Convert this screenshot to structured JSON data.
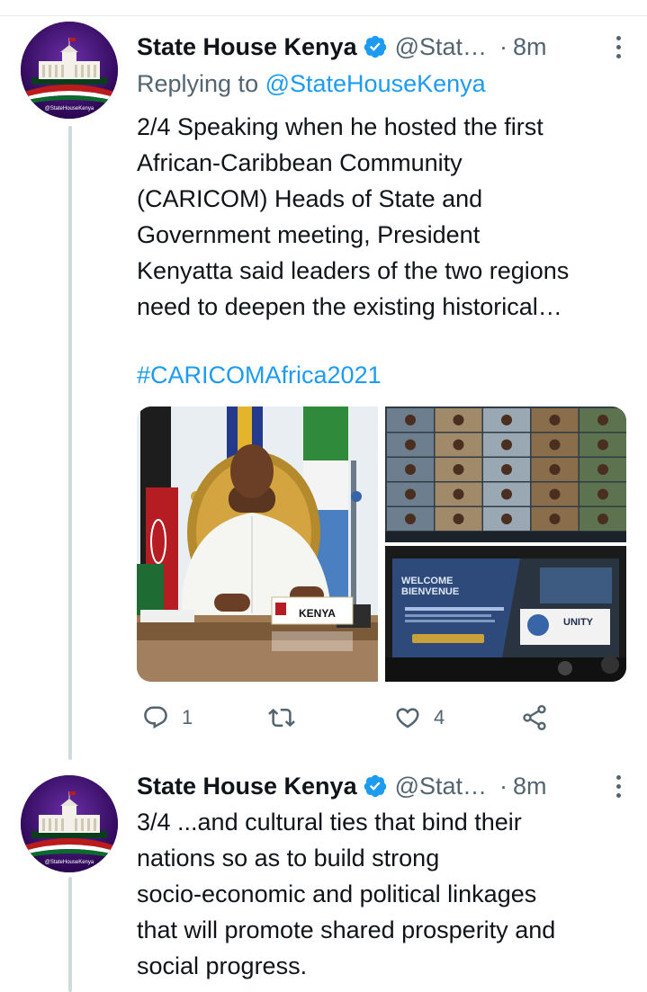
{
  "tweets": [
    {
      "author_name": "State House Kenya",
      "handle": "@Stat…",
      "separator": "·",
      "time": "8m",
      "reply_prefix": "Replying to",
      "reply_to": "@StateHouseKenya",
      "text_lines": [
        "2/4 Speaking when he hosted the first",
        "African-Caribbean Community",
        "(CARICOM) Heads of State and",
        "Government meeting, President",
        "Kenyatta said leaders of the two regions",
        "need to deepen the existing historical…"
      ],
      "hashtag": "#CARICOMAfrica2021",
      "media": {
        "main_placard": "KENYA",
        "screen_text_1": "WELCOME",
        "screen_text_2": "BIENVENUE",
        "screen_text_3": "UNITY"
      },
      "replies": "1",
      "likes": "4"
    },
    {
      "author_name": "State House Kenya",
      "handle": "@Stat…",
      "separator": "·",
      "time": "8m",
      "text_lines": [
        "3/4 ...and cultural ties that bind their",
        "nations so as to build strong",
        "socio-economic and political linkages",
        "that will promote shared prosperity and",
        "social progress."
      ]
    }
  ],
  "avatar_caption": "@StateHouseKenya",
  "colors": {
    "link": "#1d9bf0",
    "secondary": "#536471",
    "verified": "#1d9bf0",
    "thread_line": "#cfd9de"
  },
  "icons": {
    "reply": "reply-icon",
    "retweet": "retweet-icon",
    "like": "like-icon",
    "share": "share-icon",
    "more": "more-icon",
    "verified": "verified-badge-icon"
  }
}
